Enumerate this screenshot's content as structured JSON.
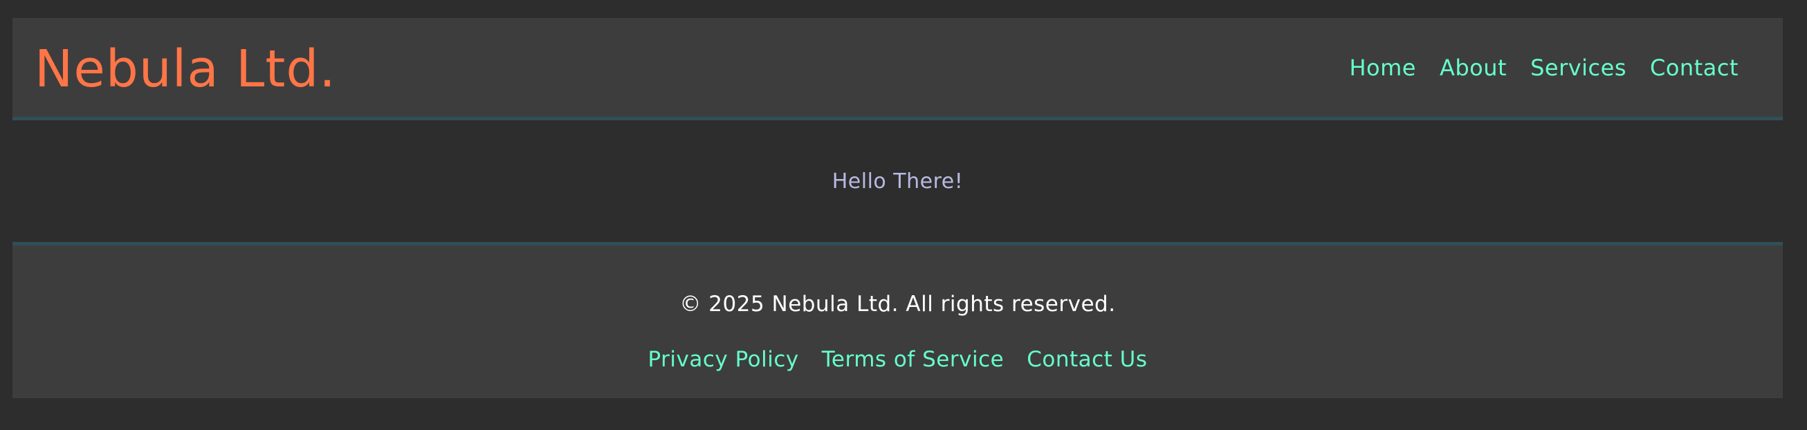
{
  "header": {
    "logo": "Nebula Ltd.",
    "nav": [
      {
        "label": "Home"
      },
      {
        "label": "About"
      },
      {
        "label": "Services"
      },
      {
        "label": "Contact"
      }
    ]
  },
  "main": {
    "greeting": "Hello There!"
  },
  "footer": {
    "copyright": "© 2025 Nebula Ltd. All rights reserved.",
    "links": [
      {
        "label": "Privacy Policy"
      },
      {
        "label": "Terms of Service"
      },
      {
        "label": "Contact Us"
      }
    ]
  },
  "colors": {
    "background": "#2d2d2d",
    "panel": "#3d3d3d",
    "border": "#2f4f5a",
    "logo": "#ff7547",
    "link": "#66ffcc",
    "greeting": "#b9b9e3",
    "text": "#ffffff"
  }
}
